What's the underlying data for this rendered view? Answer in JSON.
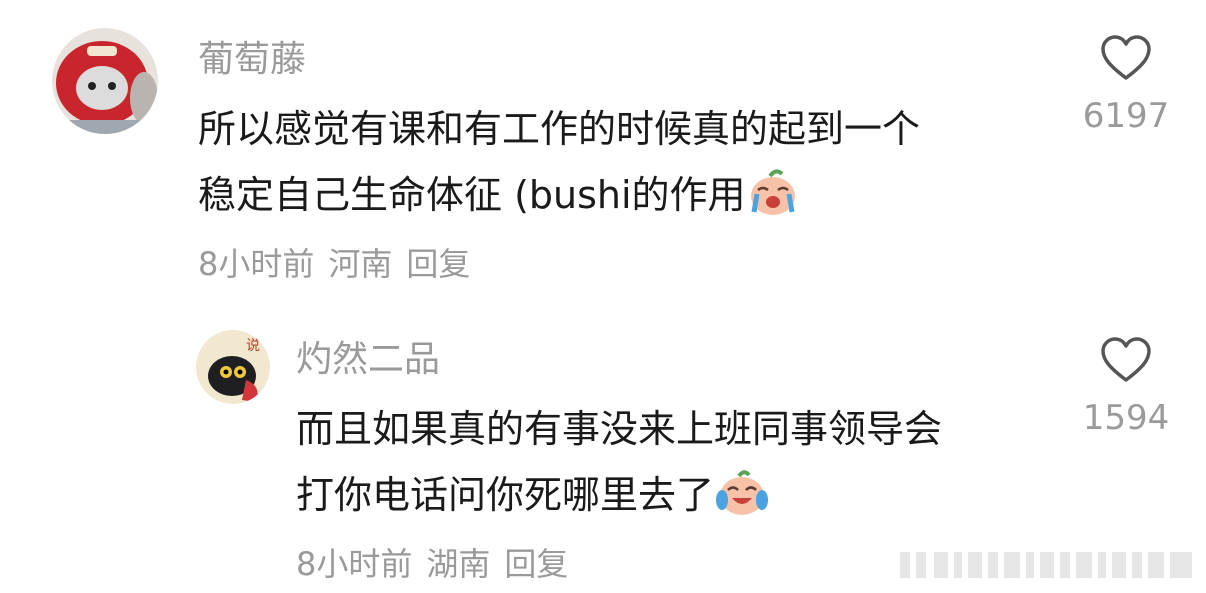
{
  "comments": [
    {
      "username": "葡萄藤",
      "text_line1": "所以感觉有课和有工作的时候真的起到一个",
      "text_line2": "稳定自己生命体征 (bushi的作用",
      "emoji_icon": "crying-face-emoji",
      "time": "8小时前",
      "location": "河南",
      "reply_label": "回复",
      "likes": "6197"
    },
    {
      "username": "灼然二品",
      "text_line1": "而且如果真的有事没来上班同事领导会",
      "text_line2": "打你电话问你死哪里去了",
      "emoji_icon": "laughing-crying-emoji",
      "time": "8小时前",
      "location": "湖南",
      "reply_label": "回复",
      "likes": "1594"
    }
  ],
  "colors": {
    "text": "#1a1a1a",
    "muted": "#9a9a9a",
    "background": "#ffffff"
  },
  "icons": {
    "like": "heart-outline-icon"
  }
}
